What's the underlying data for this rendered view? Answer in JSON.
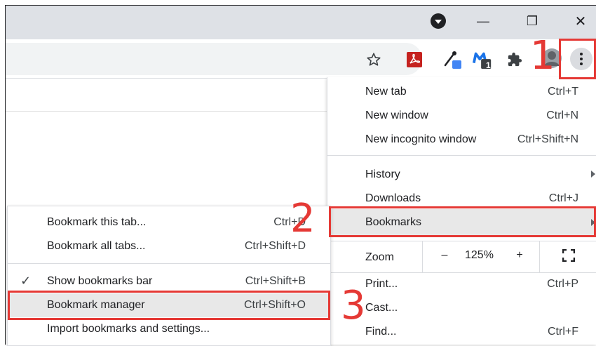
{
  "window": {
    "controls": {
      "minimize": "—",
      "restore": "❐",
      "close": "✕"
    }
  },
  "toolbar": {
    "icons": [
      "star-icon",
      "pdf-extension-icon",
      "eyedropper-extension-icon",
      "m-extension-icon",
      "puzzle-extensions-icon",
      "profile-avatar",
      "kebab-menu-icon"
    ],
    "m_badge": "1"
  },
  "menu": {
    "items": [
      {
        "label": "New tab",
        "shortcut": "Ctrl+T"
      },
      {
        "label": "New window",
        "shortcut": "Ctrl+N"
      },
      {
        "label": "New incognito window",
        "shortcut": "Ctrl+Shift+N"
      },
      {
        "label": "History",
        "shortcut": ""
      },
      {
        "label": "Downloads",
        "shortcut": "Ctrl+J"
      },
      {
        "label": "Bookmarks",
        "shortcut": ""
      },
      {
        "label": "Print...",
        "shortcut": "Ctrl+P"
      },
      {
        "label": "Cast...",
        "shortcut": ""
      },
      {
        "label": "Find...",
        "shortcut": "Ctrl+F"
      }
    ],
    "zoom": {
      "label": "Zoom",
      "minus": "–",
      "value": "125%",
      "plus": "+"
    }
  },
  "submenu": {
    "items": [
      {
        "label": "Bookmark this tab...",
        "shortcut": "Ctrl+D"
      },
      {
        "label": "Bookmark all tabs...",
        "shortcut": "Ctrl+Shift+D"
      },
      {
        "label": "Show bookmarks bar",
        "shortcut": "Ctrl+Shift+B",
        "check": "✓"
      },
      {
        "label": "Bookmark manager",
        "shortcut": "Ctrl+Shift+O"
      },
      {
        "label": "Import bookmarks and settings...",
        "shortcut": ""
      }
    ]
  },
  "annotations": {
    "step1": "1",
    "step2": "2",
    "step3": "3"
  },
  "colors": {
    "annotation": "#e53935",
    "titlebar": "#dee1e6",
    "highlight": "#e8e8e8"
  }
}
